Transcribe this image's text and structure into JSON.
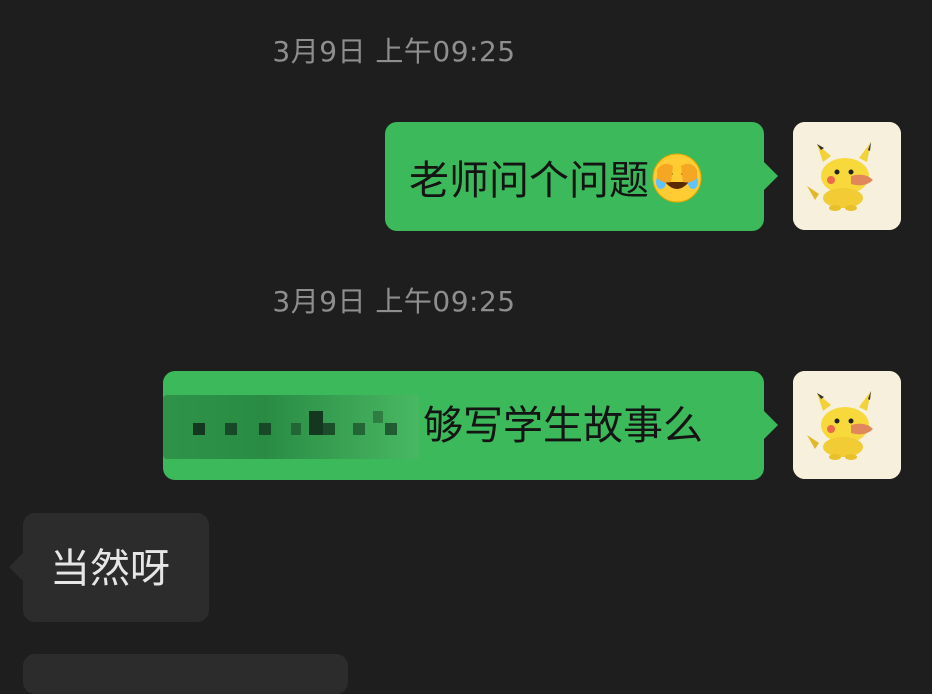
{
  "messages": [
    {
      "timestamp": "3月9日 上午09:25",
      "direction": "outgoing",
      "text": "老师问个问题",
      "emoji": "face-with-tears-of-joy-covering-face"
    },
    {
      "timestamp": "3月9日 上午09:25",
      "direction": "outgoing",
      "text": "够写学生故事么",
      "redacted_prefix": true
    },
    {
      "direction": "incoming",
      "text": "当然呀"
    }
  ],
  "colors": {
    "background": "#1e1e1e",
    "outgoing_bubble": "#3cb95a",
    "incoming_bubble": "#2c2c2c",
    "timestamp": "#8e8e8e",
    "avatar_bg": "#f6f0dc"
  },
  "avatar": {
    "icon": "pikachu-avatar"
  }
}
